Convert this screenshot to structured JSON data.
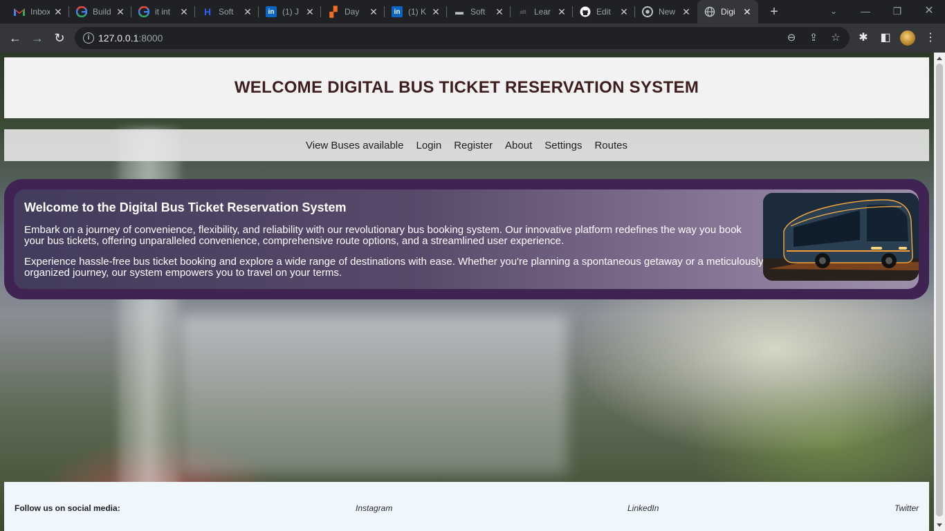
{
  "browser": {
    "tabs": [
      {
        "title": "Inbox",
        "icon": "gmail-icon",
        "color": "#ea4335"
      },
      {
        "title": "Build",
        "icon": "google-icon",
        "color": "#4285f4"
      },
      {
        "title": "it int",
        "icon": "google-icon",
        "color": "#4285f4"
      },
      {
        "title": "Soft",
        "icon": "hashnode-icon",
        "color": "#2962ff"
      },
      {
        "title": "(1) J",
        "icon": "linkedin-icon",
        "color": "#0a66c2"
      },
      {
        "title": "Day",
        "icon": "dayjob-icon",
        "color": "#f26b21"
      },
      {
        "title": "(1) K",
        "icon": "linkedin-icon",
        "color": "#0a66c2"
      },
      {
        "title": "Soft",
        "icon": "laptop-icon",
        "color": "#bdc1c6"
      },
      {
        "title": "Lear",
        "icon": "learn-icon",
        "color": "#666666"
      },
      {
        "title": "Edit",
        "icon": "github-icon",
        "color": "#ffffff"
      },
      {
        "title": "New",
        "icon": "chrome-icon",
        "color": "#bdc1c6"
      },
      {
        "title": "Digi",
        "icon": "globe-icon",
        "color": "#bdc1c6"
      }
    ],
    "active_tab_index": 11,
    "address": {
      "host": "127.0.0.1",
      "port": ":8000"
    }
  },
  "site": {
    "title": "WELCOME DIGITAL BUS TICKET RESERVATION SYSTEM",
    "nav": [
      "View Buses available",
      "Login",
      "Register",
      "About",
      "Settings",
      "Routes"
    ],
    "hero": {
      "heading": "Welcome to the Digital Bus Ticket Reservation System",
      "paragraph1": "Embark on a journey of convenience, flexibility, and reliability with our revolutionary bus booking system. Our innovative platform redefines the way you book your bus tickets, offering unparalleled convenience, comprehensive route options, and a streamlined user experience.",
      "paragraph2": "Experience hassle-free bus ticket booking and explore a wide range of destinations with ease. Whether you're planning a spontaneous getaway or a meticulously organized journey, our system empowers you to travel on your terms."
    },
    "footer": {
      "label": "Follow us on social media:",
      "links": [
        "Instagram",
        "LinkedIn",
        "Twitter"
      ]
    }
  },
  "colors": {
    "header_text": "#3d1d1d",
    "hero_border": "#3f2352",
    "footer_bg": "#f0f7fc"
  }
}
